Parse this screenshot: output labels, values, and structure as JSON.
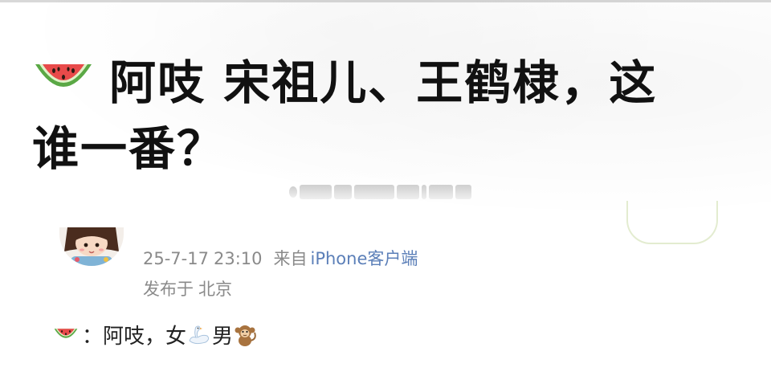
{
  "post": {
    "title_line1": "阿吱 宋祖儿、王鹤棣，这",
    "title_line2": "谁一番？",
    "title_icon": "watermelon-icon"
  },
  "author": {
    "avatar_icon": "avatar-girl-cartoon",
    "date": "25-7-17",
    "time": "23:10",
    "source_prefix": "来自",
    "device": "iPhone客户端",
    "location_prefix": "发布于",
    "location": "北京"
  },
  "comment": {
    "icon": "watermelon-icon",
    "separator": "：",
    "text_part1": "阿吱，女",
    "swan_icon": "swan-icon",
    "text_part2": "男",
    "monkey_icon": "monkey-icon"
  },
  "colors": {
    "title_text": "#111111",
    "meta_text": "#8a8a8a",
    "device_link": "#5b7fb8",
    "watermelon_rind": "#5aa845",
    "watermelon_flesh": "#e84a4a"
  }
}
